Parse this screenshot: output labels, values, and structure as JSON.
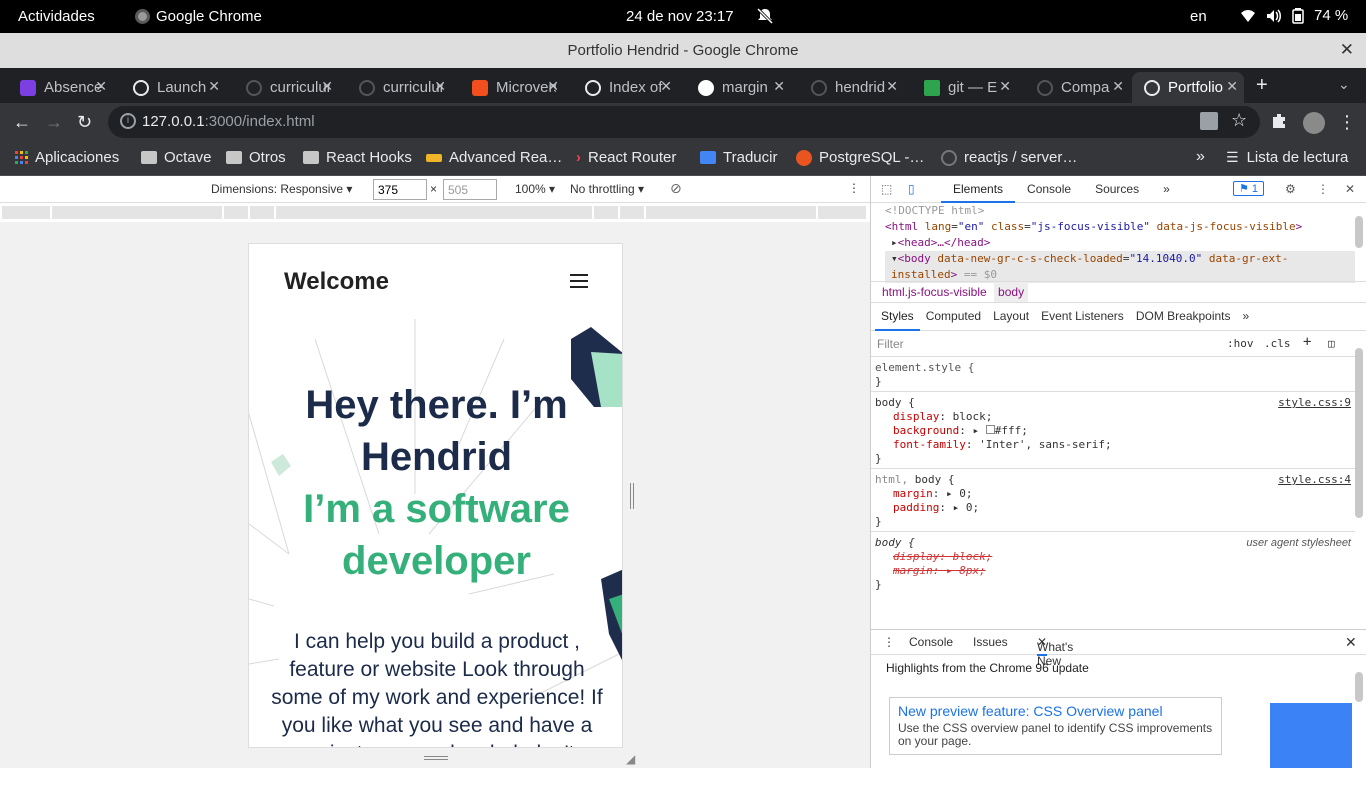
{
  "system": {
    "activities": "Actividades",
    "app_name": "Google Chrome",
    "clock": "24 de nov  23:17",
    "lang": "en",
    "battery": "74 %"
  },
  "window": {
    "title": "Portfolio Hendrid - Google Chrome"
  },
  "tabs": [
    {
      "label": "Absence",
      "color": "#7b3fe4"
    },
    {
      "label": "Launch",
      "color": "#e8eaed"
    },
    {
      "label": "curriculum",
      "color": "#444"
    },
    {
      "label": "curriculum",
      "color": "#444"
    },
    {
      "label": "Microverse",
      "color": "#f24e1e"
    },
    {
      "label": "Index of",
      "color": "#e8eaed"
    },
    {
      "label": "margin",
      "color": "#e8eaed"
    },
    {
      "label": "hendrid",
      "color": "#444"
    },
    {
      "label": "git — E",
      "color": "#2ea44f"
    },
    {
      "label": "Compa",
      "color": "#444"
    },
    {
      "label": "Portfolio",
      "color": "#e8eaed"
    }
  ],
  "address_bar": {
    "host": "127.0.0.1",
    "path": ":3000/index.html"
  },
  "bookmarks": [
    {
      "label": "Aplicaciones"
    },
    {
      "label": "Octave"
    },
    {
      "label": "Otros"
    },
    {
      "label": "React Hooks"
    },
    {
      "label": "Advanced Rea…"
    },
    {
      "label": "React Router"
    },
    {
      "label": "Traducir"
    },
    {
      "label": "PostgreSQL -…"
    },
    {
      "label": "reactjs / server…"
    }
  ],
  "reading_list": "Lista de lectura",
  "device_toolbar": {
    "dimensions_label": "Dimensions: Responsive",
    "width": "375",
    "height": "505",
    "zoom": "100%",
    "throttling": "No throttling"
  },
  "site": {
    "brand": "Welcome",
    "headline_1": "Hey there. I’m",
    "headline_2": "Hendrid",
    "sub_1": "I’m a software",
    "sub_2": "developer",
    "paragraph": "I can help you build a product , feature or website Look through some of my work and experience! If you like what you see and have a project you need coded, don't"
  },
  "devtools": {
    "tabs": [
      "Elements",
      "Console",
      "Sources"
    ],
    "issues_count": "1",
    "dom": {
      "doctype": "<!DOCTYPE html>",
      "html_tag": "html",
      "html_lang_attr": "lang",
      "html_lang_val": "\"en\"",
      "html_class_attr": "class",
      "html_class_val": "\"js-focus-visible\"",
      "html_data_attr": "data-js-focus-visible",
      "head": "<head>…</head>",
      "body_tag": "body",
      "body_attr1": "data-new-gr-c-s-check-loaded",
      "body_val1": "\"14.1040.0\"",
      "body_attr2": "data-gr-ext-",
      "body_attr2b": "installed",
      "body_eq": "== $0"
    },
    "breadcrumb": [
      "html.js-focus-visible",
      "body"
    ],
    "style_tabs": [
      "Styles",
      "Computed",
      "Layout",
      "Event Listeners",
      "DOM Breakpoints"
    ],
    "filter_placeholder": "Filter",
    "hov": ":hov",
    "cls": ".cls",
    "rules": {
      "element_style": "element.style {",
      "r1_sel": "body {",
      "r1_src": "style.css:9",
      "r1_p1n": "display",
      "r1_p1v": "block;",
      "r1_p2n": "background",
      "r1_p2v": "#fff;",
      "r1_p3n": "font-family",
      "r1_p3v": "'Inter', sans-serif;",
      "r2_sel_a": "html,",
      "r2_sel_b": "body {",
      "r2_src": "style.css:4",
      "r2_p1n": "margin",
      "r2_p1v": "0;",
      "r2_p2n": "padding",
      "r2_p2v": "0;",
      "r3_sel": "body {",
      "r3_src": "user agent stylesheet",
      "r3_p1": "display: block;",
      "r3_p2": "margin: ▸ 8px;",
      "close": "}"
    },
    "drawer_tabs": [
      "Console",
      "Issues",
      "What's New"
    ],
    "whats_new": {
      "heading": "Highlights from the Chrome 96 update",
      "card_title": "New preview feature: CSS Overview panel",
      "card_desc": "Use the CSS overview panel to identify CSS improvements on your page."
    }
  }
}
